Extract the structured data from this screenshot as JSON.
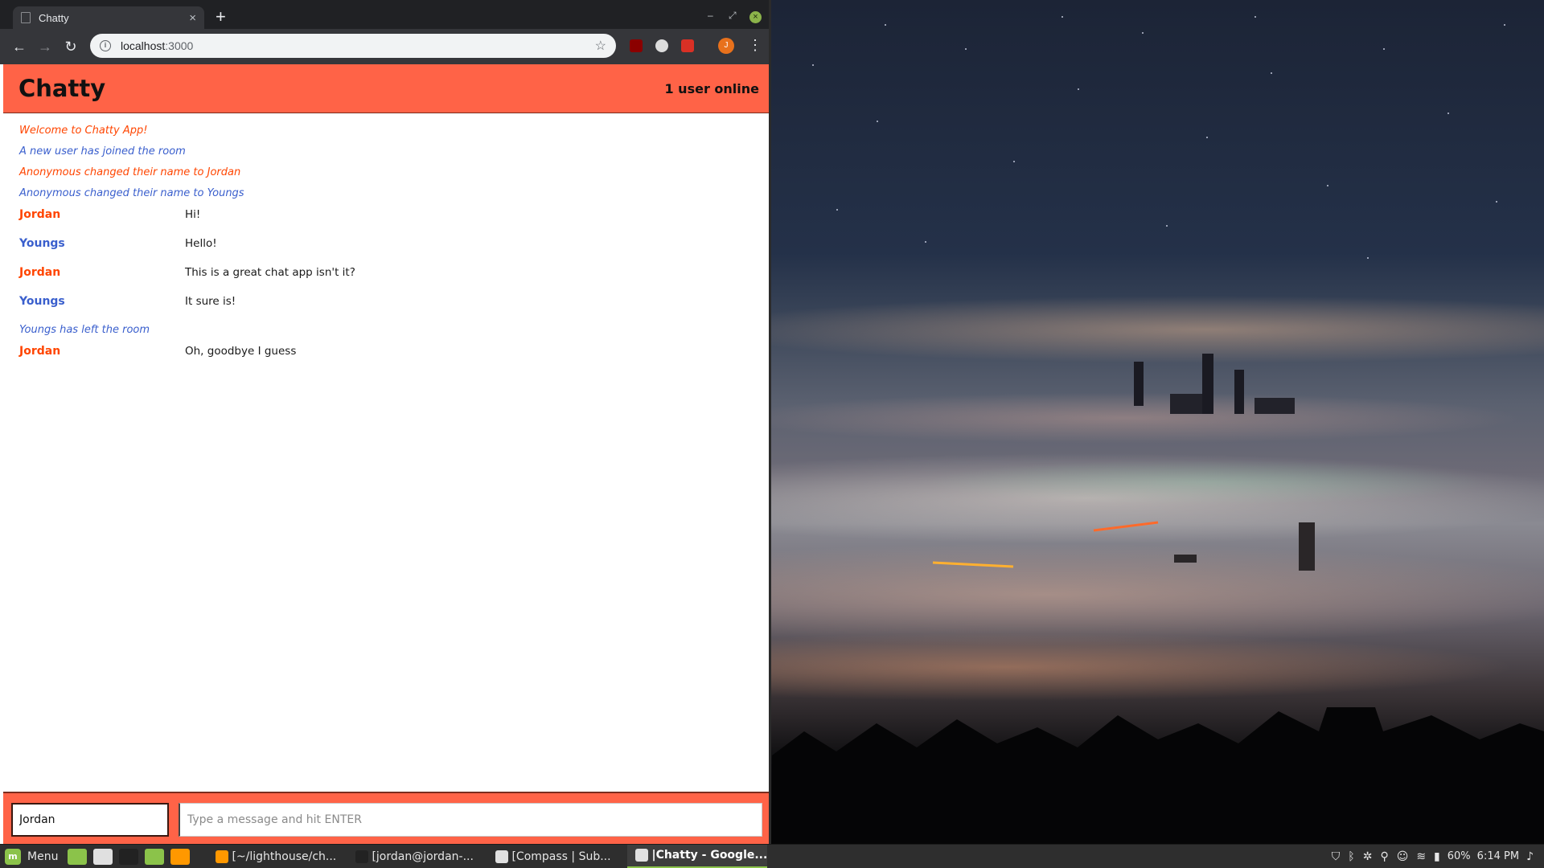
{
  "browser": {
    "tab_title": "Chatty",
    "tab_close": "×",
    "new_tab": "+",
    "minimize": "–",
    "restore": "⤢",
    "close": "×",
    "back": "←",
    "forward": "→",
    "reload": "↻",
    "url_host": "localhost",
    "url_port": ":3000",
    "bookmark": "☆",
    "profile_initial": "J",
    "menu": "⋮",
    "extensions": [
      {
        "name": "ublock-icon",
        "color": "#8b0000"
      },
      {
        "name": "privacy-badger-icon",
        "color": "#dcdcdc"
      },
      {
        "name": "extension-red-icon",
        "color": "#d93025"
      }
    ]
  },
  "app": {
    "brand": "Chatty",
    "user_count": "1 user online",
    "colors": {
      "accent": "#ff6347",
      "jordan": "#ff4500",
      "youngs": "#3a5fcd"
    },
    "messages": [
      {
        "type": "notification",
        "color": "#ff4500",
        "text": "Welcome to Chatty App!"
      },
      {
        "type": "notification",
        "color": "#3a5fcd",
        "text": "A new user has joined the room"
      },
      {
        "type": "notification",
        "color": "#ff4500",
        "text": "Anonymous changed their name to Jordan"
      },
      {
        "type": "notification",
        "color": "#3a5fcd",
        "text": "Anonymous changed their name to Youngs"
      },
      {
        "type": "message",
        "color": "#ff4500",
        "user": "Jordan",
        "text": "Hi!"
      },
      {
        "type": "message",
        "color": "#3a5fcd",
        "user": "Youngs",
        "text": "Hello!"
      },
      {
        "type": "message",
        "color": "#ff4500",
        "user": "Jordan",
        "text": "This is a great chat app isn't it?"
      },
      {
        "type": "message",
        "color": "#3a5fcd",
        "user": "Youngs",
        "text": "It sure is!"
      },
      {
        "type": "notification",
        "color": "#3a5fcd",
        "text": "Youngs has left the room"
      },
      {
        "type": "message",
        "color": "#ff4500",
        "user": "Jordan",
        "text": "Oh, goodbye I guess"
      }
    ],
    "composer": {
      "username_value": "Jordan",
      "message_value": "",
      "message_placeholder": "Type a message and hit ENTER"
    }
  },
  "taskbar": {
    "menu_label": "Menu",
    "launchers": [
      {
        "name": "files-launcher-icon",
        "color": "#8bc34a"
      },
      {
        "name": "chrome-launcher-icon",
        "color": "#e0e0e0"
      },
      {
        "name": "terminal-launcher-icon",
        "color": "#222222"
      },
      {
        "name": "folder-launcher-icon",
        "color": "#8bc34a"
      },
      {
        "name": "sublime-launcher-icon",
        "color": "#ff9800"
      }
    ],
    "tasks": [
      {
        "label": "[~/lighthouse/ch...",
        "icon_color": "#ff9800",
        "active": false
      },
      {
        "label": "[jordan@jordan-...",
        "icon_color": "#222222",
        "active": false
      },
      {
        "label": "[Compass | Sub...",
        "icon_color": "#e0e0e0",
        "active": false
      },
      {
        "label": "|Chatty - Google...",
        "icon_color": "#e0e0e0",
        "active": true
      }
    ],
    "tray": {
      "battery": "60%",
      "clock": "6:14 PM"
    }
  }
}
